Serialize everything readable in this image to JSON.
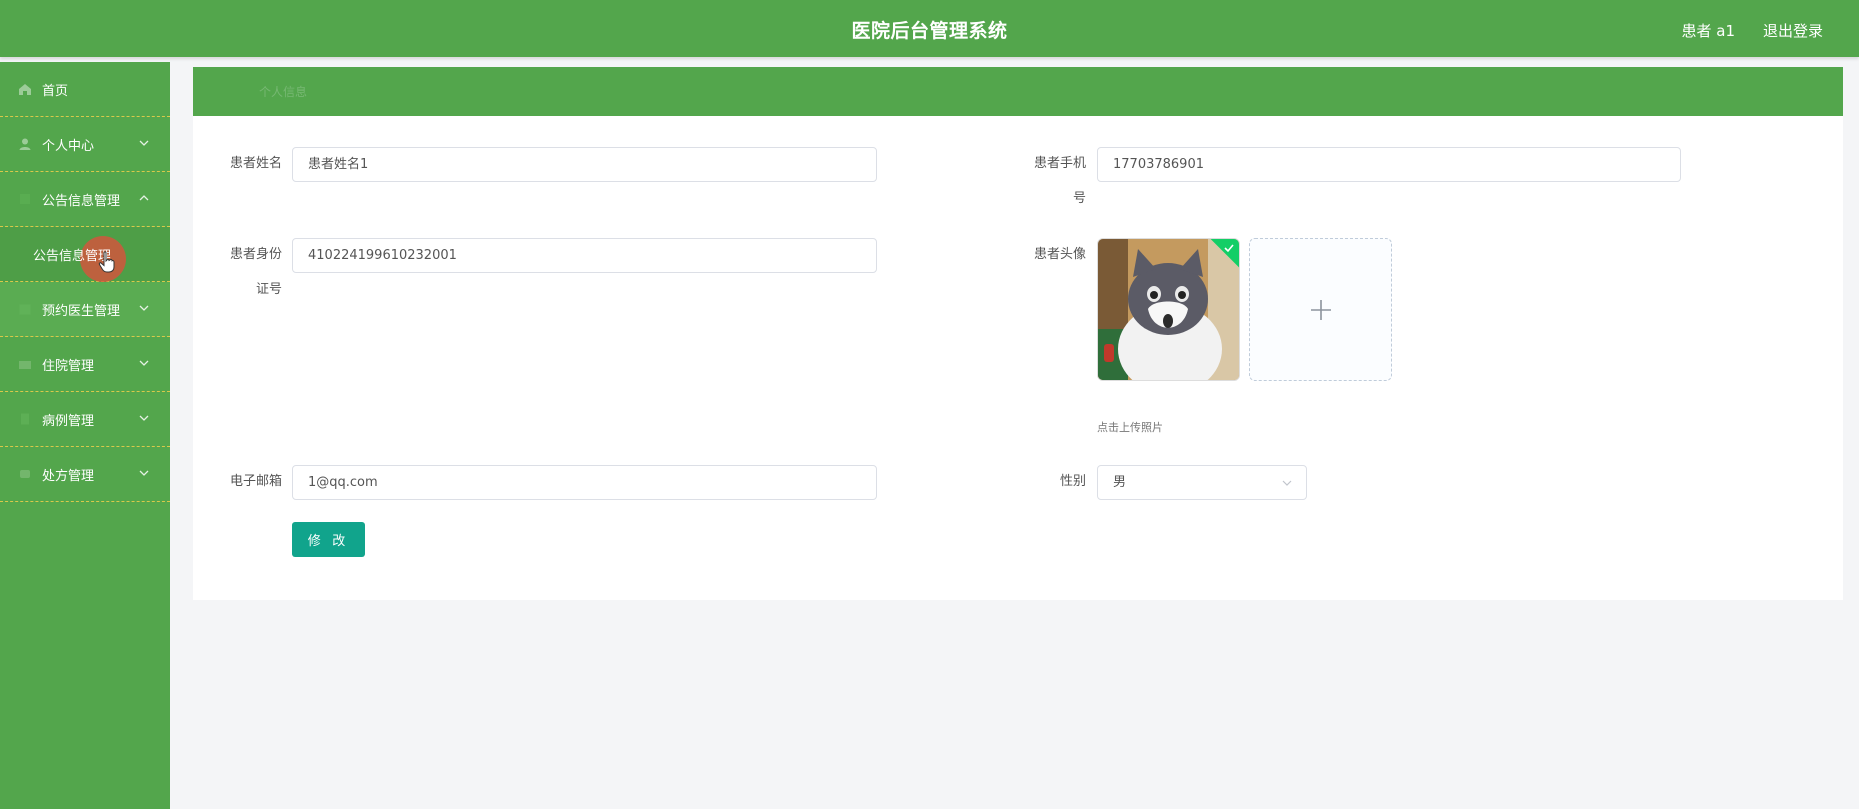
{
  "header": {
    "title": "医院后台管理系统",
    "user": "患者 a1",
    "logout": "退出登录"
  },
  "sidebar": {
    "items": [
      {
        "label": "首页",
        "icon": "home-icon",
        "expanded": false
      },
      {
        "label": "个人中心",
        "icon": "user-icon",
        "expanded": false
      },
      {
        "label": "公告信息管理",
        "icon": "notice-icon",
        "expanded": true,
        "children": [
          "公告信息管理"
        ]
      },
      {
        "label": "预约医生管理",
        "icon": "calendar-icon",
        "expanded": false
      },
      {
        "label": "住院管理",
        "icon": "bed-icon",
        "expanded": false
      },
      {
        "label": "病例管理",
        "icon": "file-icon",
        "expanded": false
      },
      {
        "label": "处方管理",
        "icon": "prescription-icon",
        "expanded": false
      }
    ]
  },
  "breadcrumb": {
    "label": "个人信息"
  },
  "form": {
    "patient_name": {
      "label": "患者姓名",
      "value": "患者姓名1"
    },
    "phone": {
      "label_line1": "患者手机",
      "label_line2": "号",
      "value": "17703786901"
    },
    "id_card": {
      "label_line1": "患者身份",
      "label_line2": "证号",
      "value": "410224199610232001"
    },
    "avatar": {
      "label": "患者头像",
      "tip": "点击上传照片",
      "uploaded": true
    },
    "email": {
      "label": "电子邮箱",
      "value": "1@qq.com"
    },
    "gender": {
      "label": "性别",
      "value": "男"
    },
    "submit_label": "修 改"
  },
  "colors": {
    "primary": "#53a64c",
    "button": "#11a48c",
    "success_badge": "#13ce66"
  }
}
